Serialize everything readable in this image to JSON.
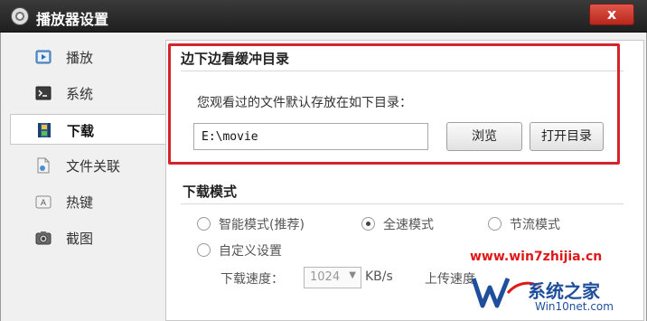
{
  "window": {
    "title": "播放器设置",
    "close_glyph": "x"
  },
  "sidebar": {
    "items": [
      {
        "label": "播放",
        "icon": "play-icon",
        "active": false
      },
      {
        "label": "系统",
        "icon": "terminal-icon",
        "active": false
      },
      {
        "label": "下载",
        "icon": "film-icon",
        "active": true
      },
      {
        "label": "文件关联",
        "icon": "file-link-icon",
        "active": false
      },
      {
        "label": "热键",
        "icon": "key-icon",
        "active": false
      },
      {
        "label": "截图",
        "icon": "camera-icon",
        "active": false
      }
    ]
  },
  "download_dir": {
    "title": "边下边看缓冲目录",
    "description": "您观看过的文件默认存放在如下目录：",
    "path_value": "E:\\movie",
    "browse_label": "浏览",
    "open_label": "打开目录"
  },
  "download_mode": {
    "title": "下载模式",
    "options": [
      {
        "label": "智能模式(推荐)",
        "checked": false
      },
      {
        "label": "全速模式",
        "checked": true
      },
      {
        "label": "节流模式",
        "checked": false
      },
      {
        "label": "自定义设置",
        "checked": false
      }
    ],
    "download_speed_label": "下载速度：",
    "download_speed_value": "1024",
    "speed_unit": "KB/s",
    "upload_speed_label": "上传速度"
  },
  "watermark": {
    "url": "www.win7zhijia.cn",
    "name": "系统之家",
    "site": "Win10net.com"
  },
  "colors": {
    "highlight_box": "#d4232a",
    "title_bar": "#2b2b2b",
    "close_button": "#c9372c"
  }
}
